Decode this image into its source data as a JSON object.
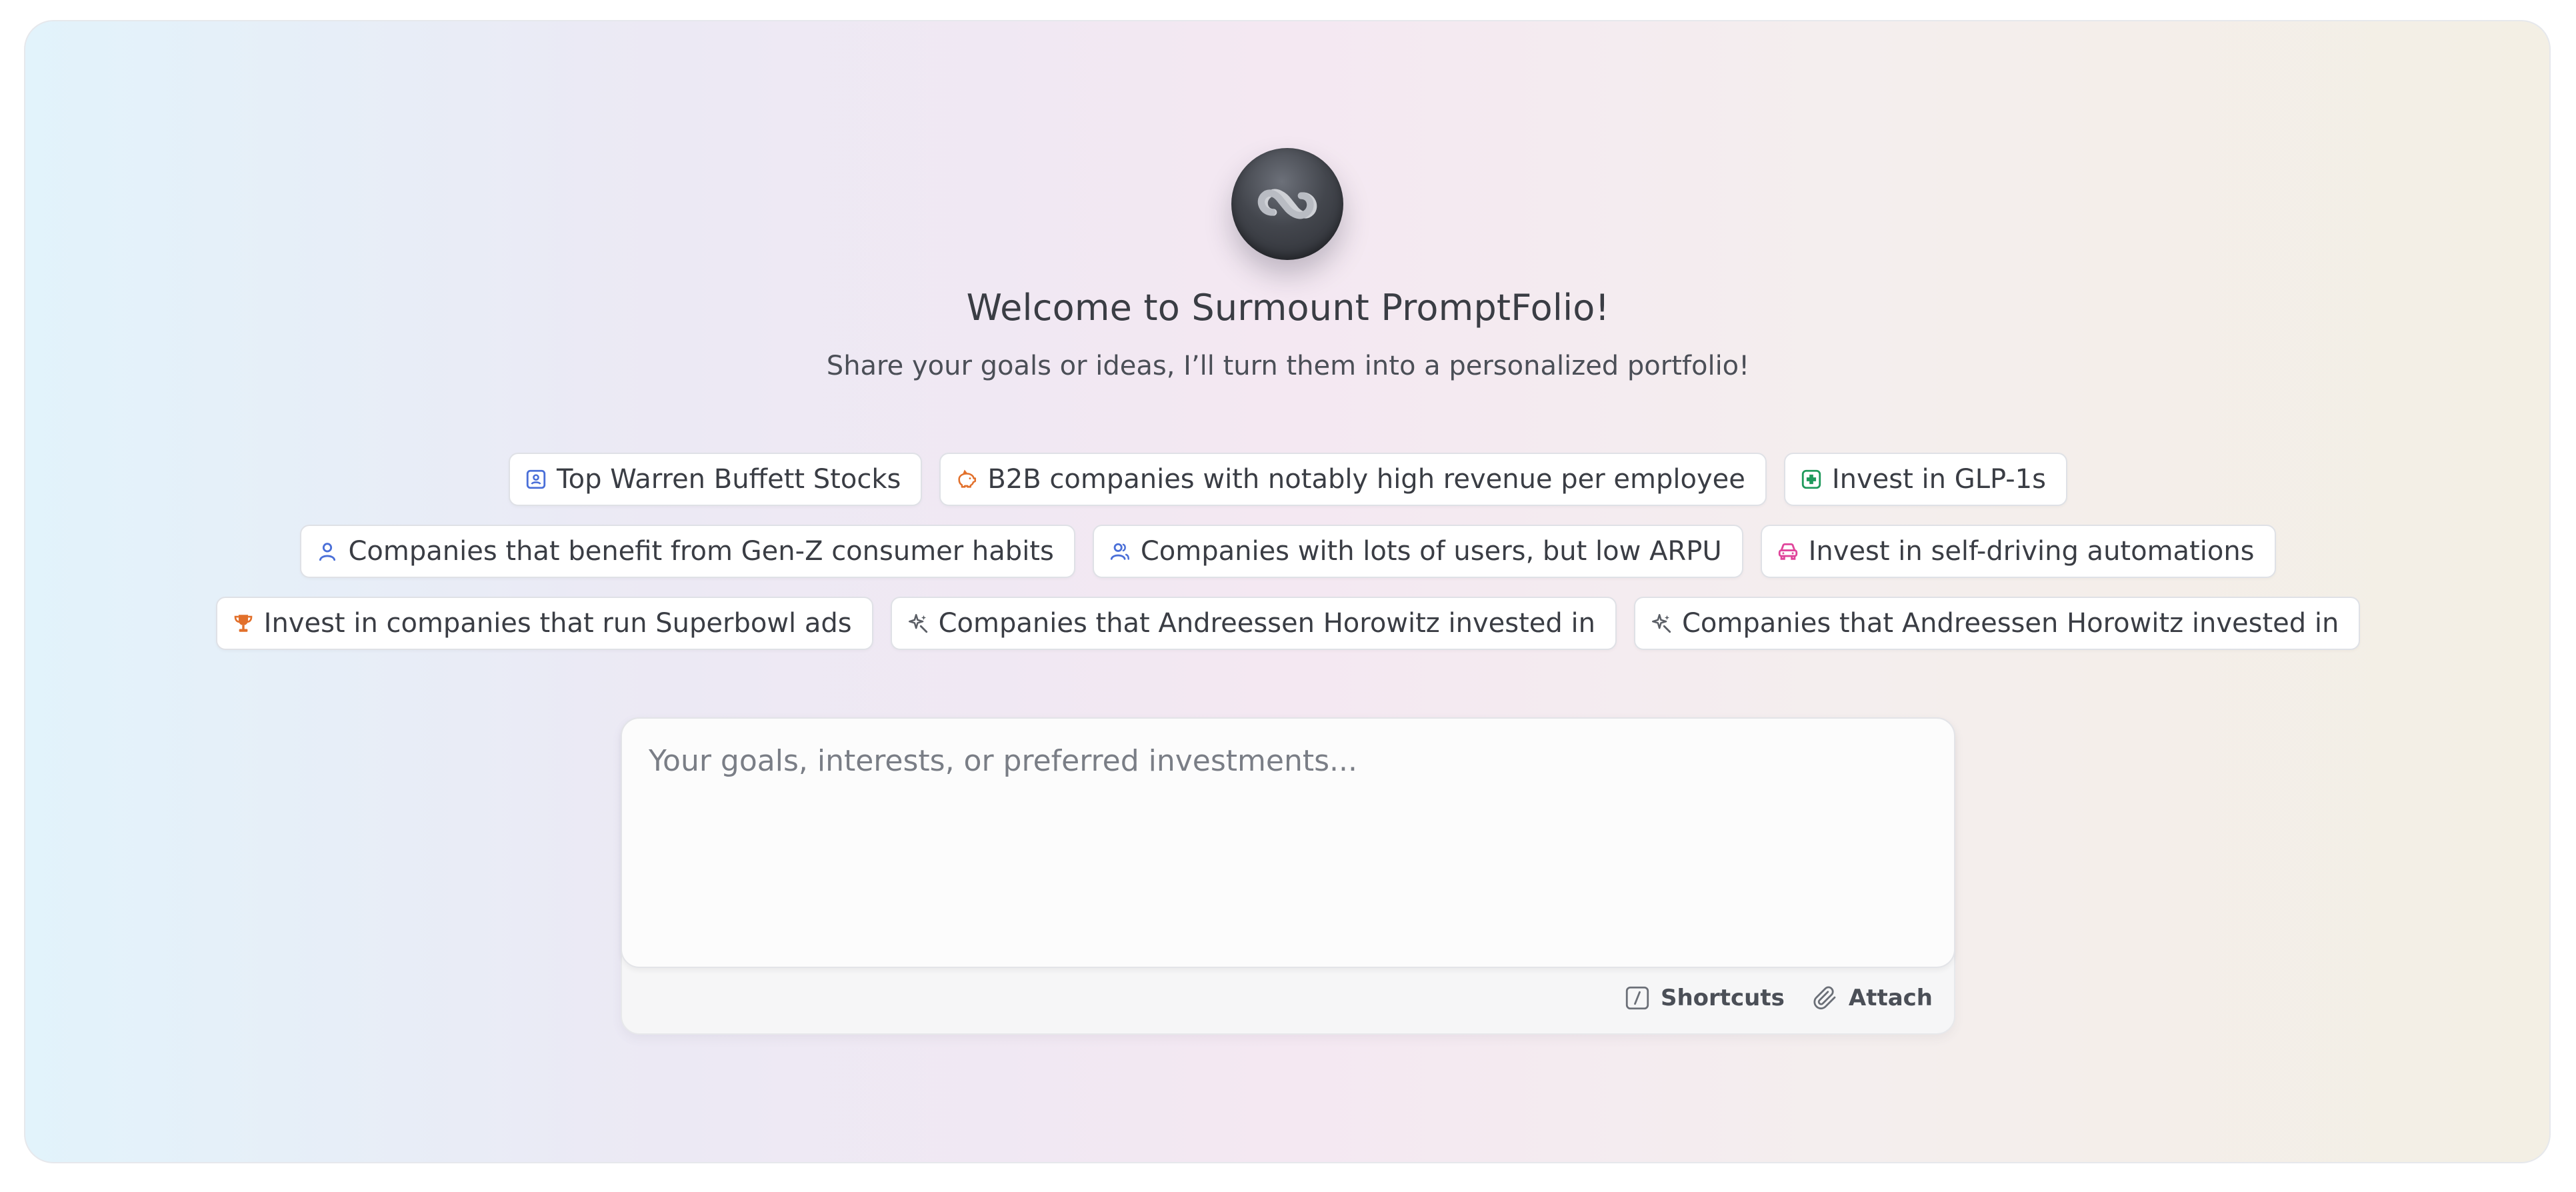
{
  "header": {
    "title": "Welcome to Surmount PromptFolio!",
    "subtitle": "Share your goals or ideas, I’ll turn them into a personalized portfolio!"
  },
  "logo": {
    "icon": "infinity-link-icon"
  },
  "suggestions": [
    {
      "label": "Top Warren Buffett Stocks",
      "icon": "id-badge-icon",
      "color": "#4a6fd8"
    },
    {
      "label": "B2B companies with notably high revenue per employee",
      "icon": "piggy-bank-icon",
      "color": "#e2702b"
    },
    {
      "label": "Invest in GLP-1s",
      "icon": "medical-cross-icon",
      "color": "#1f9a5c"
    },
    {
      "label": "Companies that benefit from Gen-Z consumer habits",
      "icon": "user-icon",
      "color": "#4a6fd8"
    },
    {
      "label": "Companies with lots of users, but low ARPU",
      "icon": "users-icon",
      "color": "#4a6fd8"
    },
    {
      "label": "Invest in self-driving automations",
      "icon": "car-icon",
      "color": "#e0459b"
    },
    {
      "label": "Invest in companies that run Superbowl ads",
      "icon": "trophy-icon",
      "color": "#e2702b"
    },
    {
      "label": "Companies that Andreessen Horowitz invested in",
      "icon": "sparkle-icon",
      "color": "#5b5f66"
    },
    {
      "label": "Companies that Andreessen Horowitz invested in",
      "icon": "sparkle-icon",
      "color": "#5b5f66"
    }
  ],
  "input": {
    "placeholder": "Your goals, interests, or preferred investments...",
    "value": ""
  },
  "toolbar": {
    "shortcuts_label": "Shortcuts",
    "attach_label": "Attach"
  }
}
